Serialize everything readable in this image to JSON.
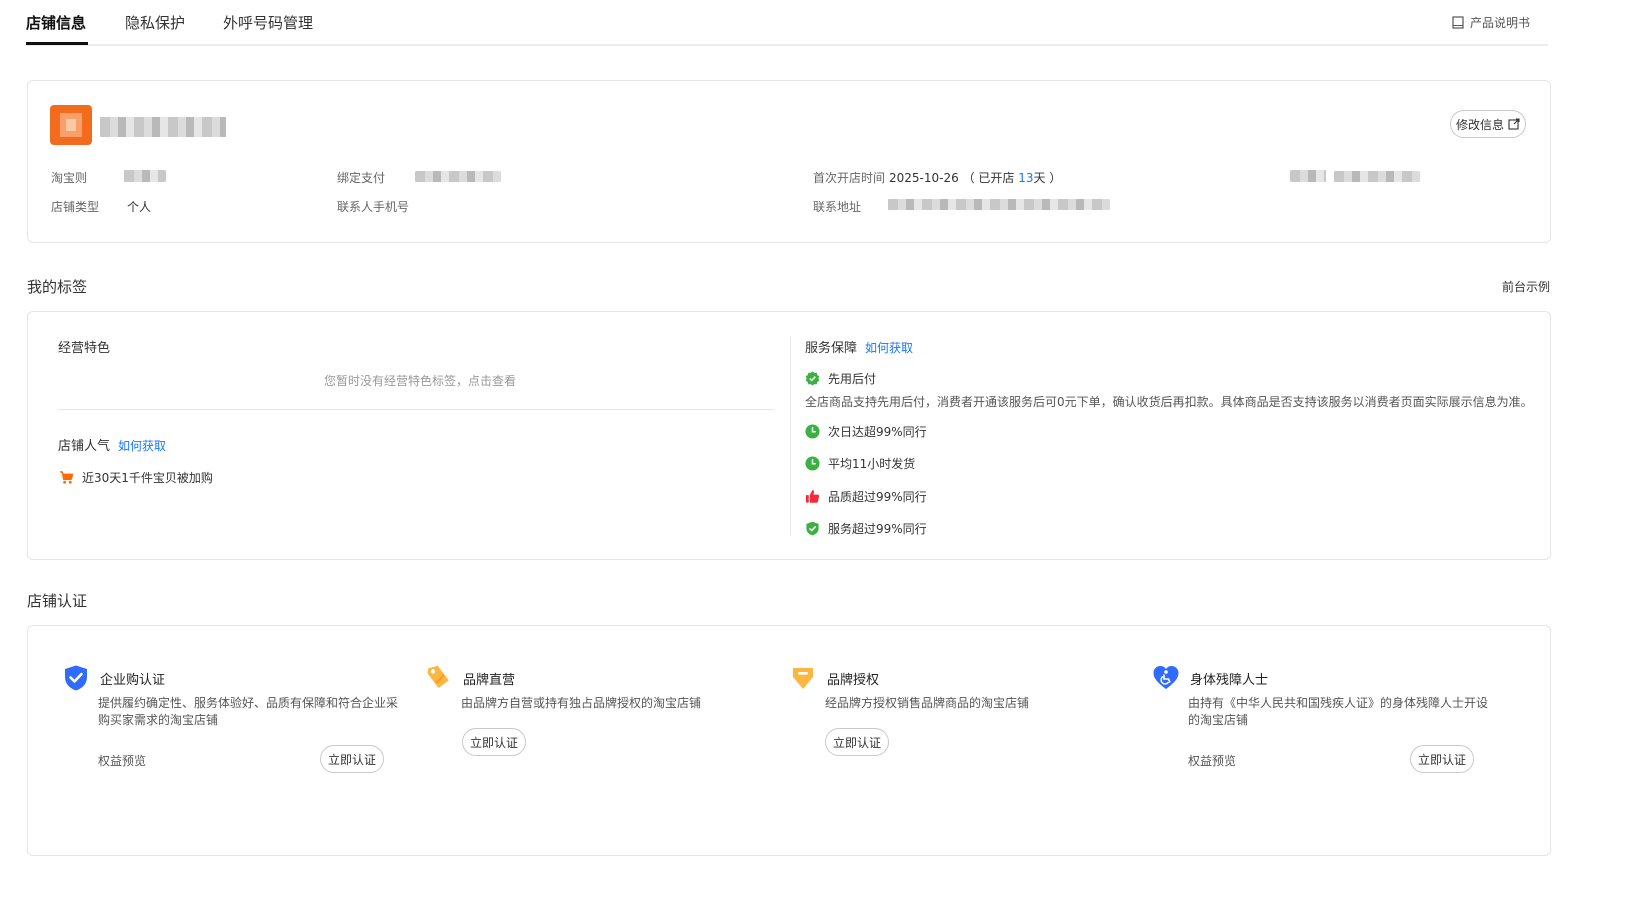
{
  "tabs": {
    "store_info": "店铺信息",
    "privacy": "隐私保护",
    "outbound": "外呼号码管理",
    "manual": "产品说明书"
  },
  "store": {
    "edit_label": "修改信息",
    "taobao_label": "淘宝则",
    "bind_label": "绑定支付",
    "store_type_label": "店铺类型",
    "store_type_value": "个人",
    "contact_phone_label": "联系人手机号",
    "open_time_label": "首次开店时间",
    "open_date": "2025-10-26",
    "open_prefix": "（ 已开店",
    "open_days": "13",
    "open_suffix": "天 ）",
    "address_label": "联系地址"
  },
  "tags": {
    "title": "我的标签",
    "front_example": "前台示例",
    "feature_title": "经营特色",
    "feature_empty": "您暂时没有经营特色标签，点击查看",
    "popularity_title": "店铺人气",
    "how_to_get": "如何获取",
    "popularity_item": "近30天1千件宝贝被加购",
    "service_title": "服务保障",
    "service_how_to_get": "如何获取",
    "pay_later": "先用后付",
    "pay_later_desc": "全店商品支持先用后付，消费者开通该服务后可0元下单，确认收货后再扣款。具体商品是否支持该服务以消费者页面实际展示信息为准。",
    "items": [
      {
        "label": "次日达超99%同行",
        "icon": "clock-icon",
        "color": "#3cb043"
      },
      {
        "label": "平均11小时发货",
        "icon": "clock-icon",
        "color": "#3cb043"
      },
      {
        "label": "品质超过99%同行",
        "icon": "thumbs-up-icon",
        "color": "#ef2b3c"
      },
      {
        "label": "服务超过99%同行",
        "icon": "shield-check-icon",
        "color": "#3cb043"
      }
    ]
  },
  "cert": {
    "title": "店铺认证",
    "items": [
      {
        "title": "企业购认证",
        "desc_line1": "提供履约确定性、服务体验好、品质有保障和符合企业采",
        "desc_line2": "购买家需求的淘宝店铺",
        "benefit": "权益预览",
        "button": "立即认证"
      },
      {
        "title": "品牌直营",
        "desc_line1": "由品牌方自营或持有独占品牌授权的淘宝店铺",
        "button": "立即认证"
      },
      {
        "title": "品牌授权",
        "desc_line1": "经品牌方授权销售品牌商品的淘宝店铺",
        "button": "立即认证"
      },
      {
        "title": "身体残障人士",
        "desc_line1": "由持有《中华人民共和国残疾人证》的身体残障人士开设",
        "desc_line2": "的淘宝店铺",
        "benefit": "权益预览",
        "button": "立即认证"
      }
    ]
  },
  "colors": {
    "accent_blue": "#1677ff",
    "brand_orange": "#f36b1c",
    "green": "#3cb043"
  }
}
